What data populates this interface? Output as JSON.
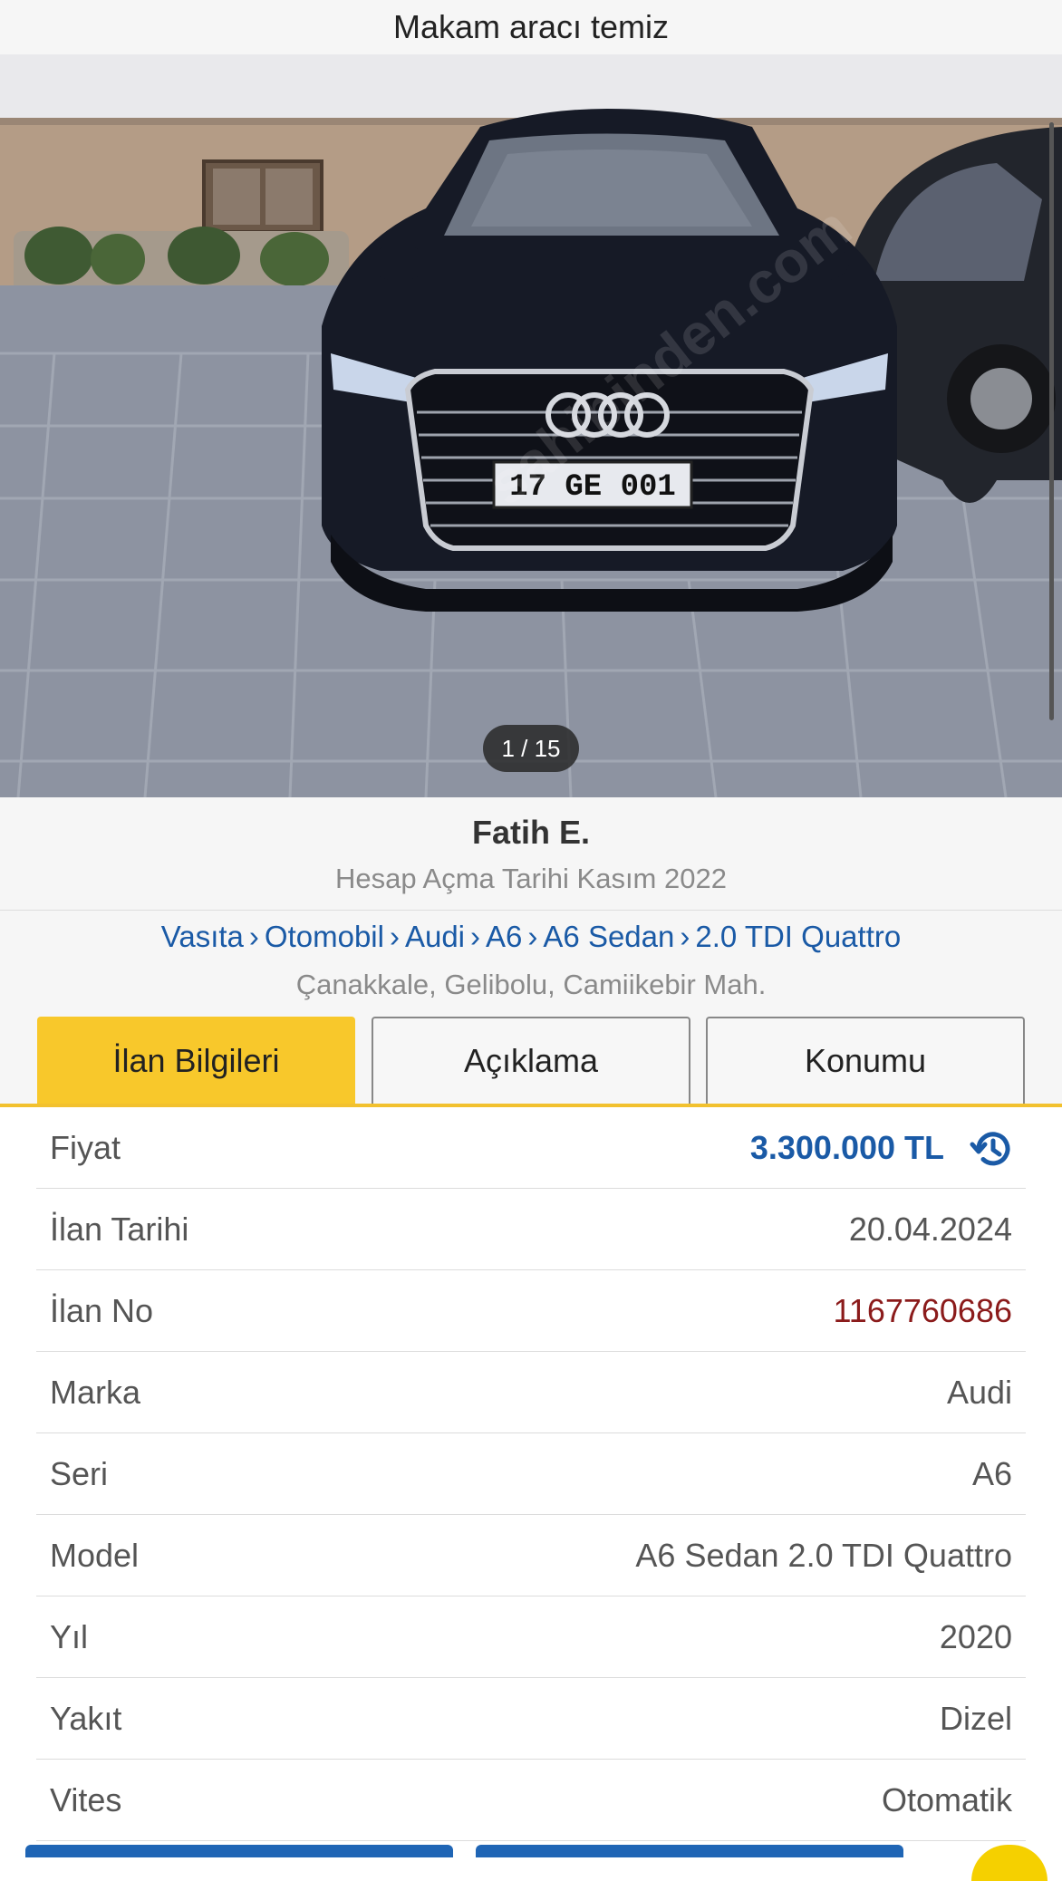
{
  "header": {
    "title": "Makam aracı temiz"
  },
  "gallery": {
    "counter": "1 / 15",
    "photo_icon": "car-photo",
    "plate_text": "17 GE 001",
    "watermark": "sahibinden.com"
  },
  "seller": {
    "name": "Fatih E.",
    "since": "Hesap Açma Tarihi Kasım 2022"
  },
  "breadcrumb": {
    "items": [
      "Vasıta",
      "Otomobil",
      "Audi",
      "A6",
      "A6 Sedan",
      "2.0 TDI Quattro"
    ],
    "separator": "›"
  },
  "location": "Çanakkale, Gelibolu, Camiikebir Mah.",
  "tabs": [
    {
      "label": "İlan Bilgileri",
      "active": true
    },
    {
      "label": "Açıklama",
      "active": false
    },
    {
      "label": "Konumu",
      "active": false
    }
  ],
  "details": [
    {
      "key": "Fiyat",
      "value": "3.300.000 TL"
    },
    {
      "key": "İlan Tarihi",
      "value": "20.04.2024"
    },
    {
      "key": "İlan No",
      "value": "1167760686"
    },
    {
      "key": "Marka",
      "value": "Audi"
    },
    {
      "key": "Seri",
      "value": "A6"
    },
    {
      "key": "Model",
      "value": "A6 Sedan 2.0 TDI Quattro"
    },
    {
      "key": "Yıl",
      "value": "2020"
    },
    {
      "key": "Yakıt",
      "value": "Dizel"
    },
    {
      "key": "Vites",
      "value": "Otomatik"
    }
  ],
  "icons": {
    "price_history": "history-icon"
  },
  "colors": {
    "accent": "#f8c82b",
    "link": "#1a5aa6",
    "ad_number": "#8b1b1b"
  }
}
